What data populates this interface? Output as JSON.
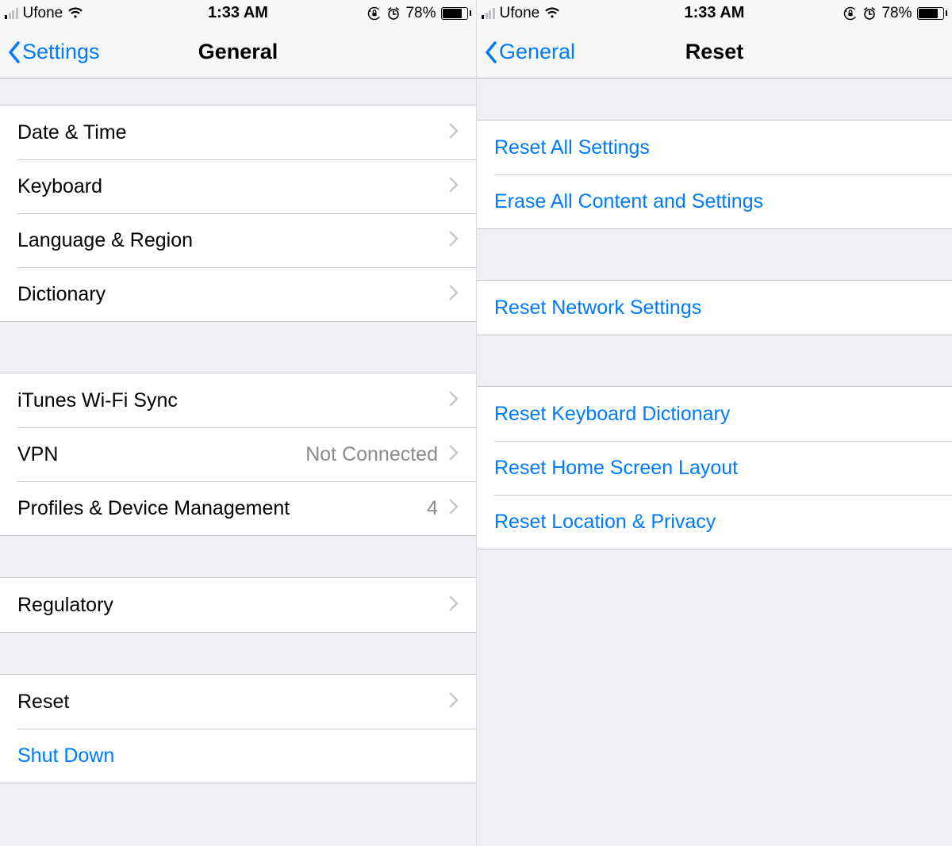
{
  "status": {
    "carrier": "Ufone",
    "time": "1:33 AM",
    "battery_pct": "78%"
  },
  "left": {
    "nav": {
      "back": "Settings",
      "title": "General"
    },
    "groups": [
      [
        {
          "label": "Date & Time"
        },
        {
          "label": "Keyboard"
        },
        {
          "label": "Language & Region"
        },
        {
          "label": "Dictionary"
        }
      ],
      [
        {
          "label": "iTunes Wi-Fi Sync"
        },
        {
          "label": "VPN",
          "value": "Not Connected"
        },
        {
          "label": "Profiles & Device Management",
          "value": "4"
        }
      ],
      [
        {
          "label": "Regulatory"
        }
      ],
      [
        {
          "label": "Reset"
        },
        {
          "label": "Shut Down",
          "blue": true,
          "no_chevron": true
        }
      ]
    ]
  },
  "right": {
    "nav": {
      "back": "General",
      "title": "Reset"
    },
    "groups": [
      [
        {
          "label": "Reset All Settings"
        },
        {
          "label": "Erase All Content and Settings"
        }
      ],
      [
        {
          "label": "Reset Network Settings"
        }
      ],
      [
        {
          "label": "Reset Keyboard Dictionary"
        },
        {
          "label": "Reset Home Screen Layout"
        },
        {
          "label": "Reset Location & Privacy"
        }
      ]
    ]
  }
}
